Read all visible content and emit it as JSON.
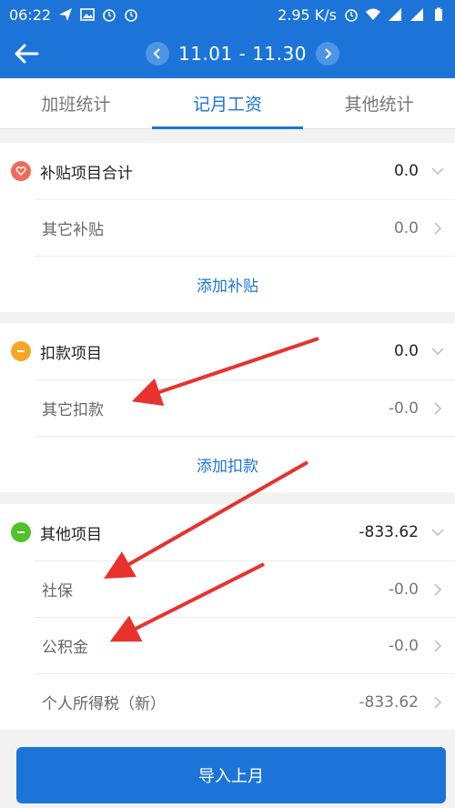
{
  "status_bar": {
    "time": "06:22",
    "speed": "2.95 K/s"
  },
  "header": {
    "date_range": "11.01 - 11.30"
  },
  "tabs": [
    {
      "label": "加班统计",
      "active": false
    },
    {
      "label": "记月工资",
      "active": true
    },
    {
      "label": "其他统计",
      "active": false
    }
  ],
  "sections": {
    "subsidy": {
      "title": "补贴项目合计",
      "total": "0.0",
      "items": [
        {
          "label": "其它补贴",
          "value": "0.0"
        }
      ],
      "add_label": "添加补贴"
    },
    "deduction": {
      "title": "扣款项目",
      "total": "0.0",
      "items": [
        {
          "label": "其它扣款",
          "value": "-0.0"
        }
      ],
      "add_label": "添加扣款"
    },
    "other": {
      "title": "其他项目",
      "total": "-833.62",
      "items": [
        {
          "label": "社保",
          "value": "-0.0"
        },
        {
          "label": "公积金",
          "value": "-0.0"
        },
        {
          "label": "个人所得税（新）",
          "value": "-833.62"
        }
      ]
    }
  },
  "import_button": "导入上月",
  "colors": {
    "primary": "#1d74d8",
    "subsidy_dot": "#ef6b5b",
    "deduction_dot": "#f5a623",
    "other_dot": "#52c12a",
    "arrow": "#e8322d"
  }
}
